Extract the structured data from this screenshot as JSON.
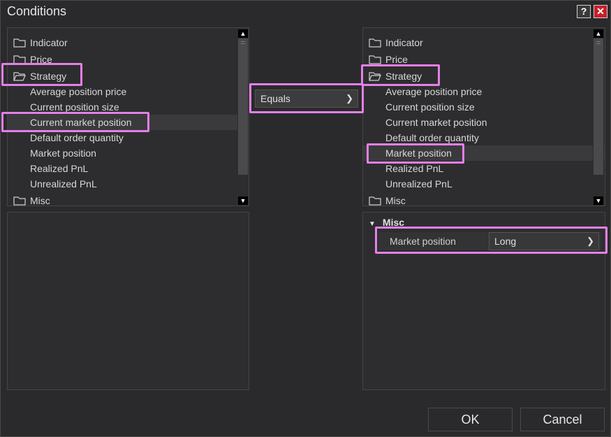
{
  "window": {
    "title": "Conditions",
    "help_label": "?",
    "close_label": "✕"
  },
  "left_tree": {
    "items": [
      {
        "label": "Indicator"
      },
      {
        "label": "Price"
      },
      {
        "label": "Strategy"
      },
      {
        "label": "Average position price"
      },
      {
        "label": "Current position size"
      },
      {
        "label": "Current market position"
      },
      {
        "label": "Default order quantity"
      },
      {
        "label": "Market position"
      },
      {
        "label": "Realized PnL"
      },
      {
        "label": "Unrealized PnL"
      },
      {
        "label": "Misc"
      }
    ],
    "selected": "Current market position"
  },
  "operator": {
    "value": "Equals"
  },
  "right_tree": {
    "items": [
      {
        "label": "Indicator"
      },
      {
        "label": "Price"
      },
      {
        "label": "Strategy"
      },
      {
        "label": "Average position price"
      },
      {
        "label": "Current position size"
      },
      {
        "label": "Current market position"
      },
      {
        "label": "Default order quantity"
      },
      {
        "label": "Market position"
      },
      {
        "label": "Realized PnL"
      },
      {
        "label": "Unrealized PnL"
      },
      {
        "label": "Misc"
      }
    ],
    "selected": "Market position"
  },
  "properties": {
    "section": "Misc",
    "property_label": "Market position",
    "property_value": "Long"
  },
  "buttons": {
    "ok": "OK",
    "cancel": "Cancel"
  },
  "colors": {
    "highlight": "#e47fe9",
    "close": "#c8202a"
  }
}
